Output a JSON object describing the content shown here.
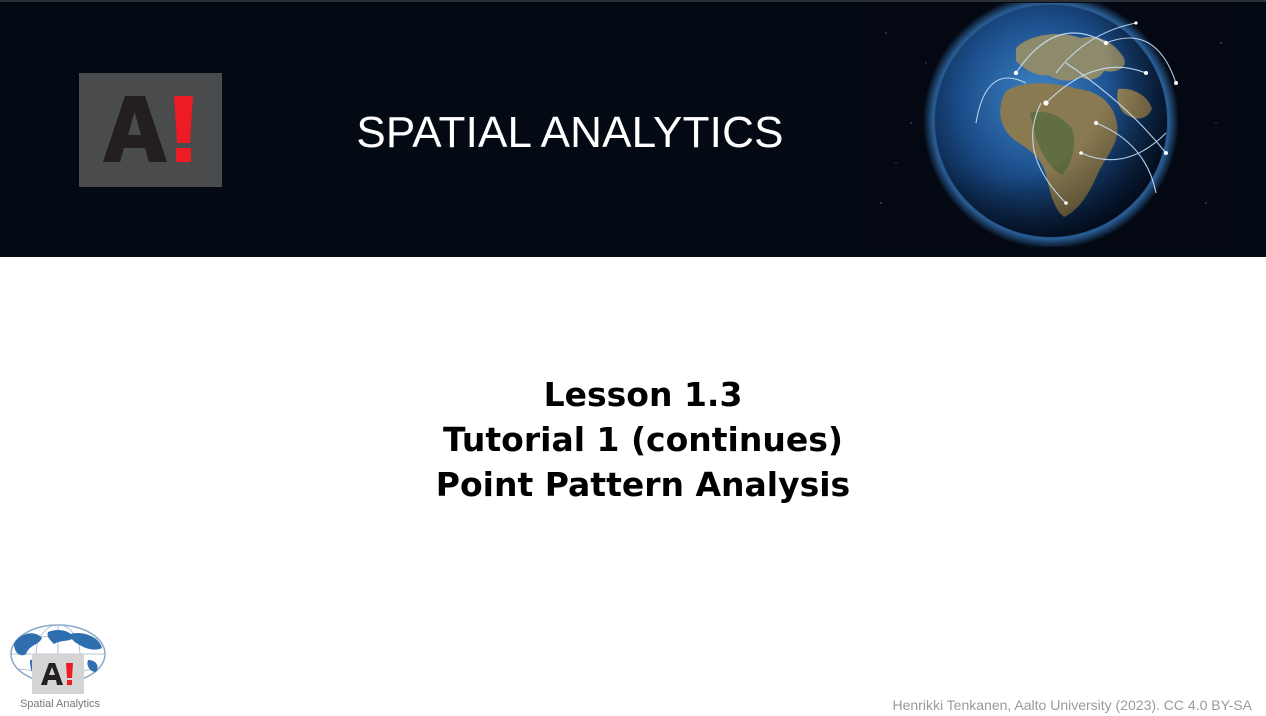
{
  "header": {
    "logo_text": "A!",
    "title": "SPATIAL ANALYTICS",
    "image": "earth-globe-with-network-connections"
  },
  "main": {
    "lines": [
      "Lesson 1.3",
      "Tutorial 1 (continues)",
      "Point Pattern Analysis"
    ]
  },
  "footer": {
    "logo_text": "A!",
    "logo_label": "Spatial Analytics",
    "credit": "Henrikki Tenkanen, Aalto University (2023). CC 4.0 BY-SA"
  },
  "colors": {
    "banner_background": "#040a13",
    "logo_box": "#4a4b4d",
    "logo_letter": "#231f20",
    "logo_exclamation": "#ed1c24",
    "title_text": "#ffffff",
    "body_text": "#000000",
    "credit_text": "#9a9a9a"
  }
}
